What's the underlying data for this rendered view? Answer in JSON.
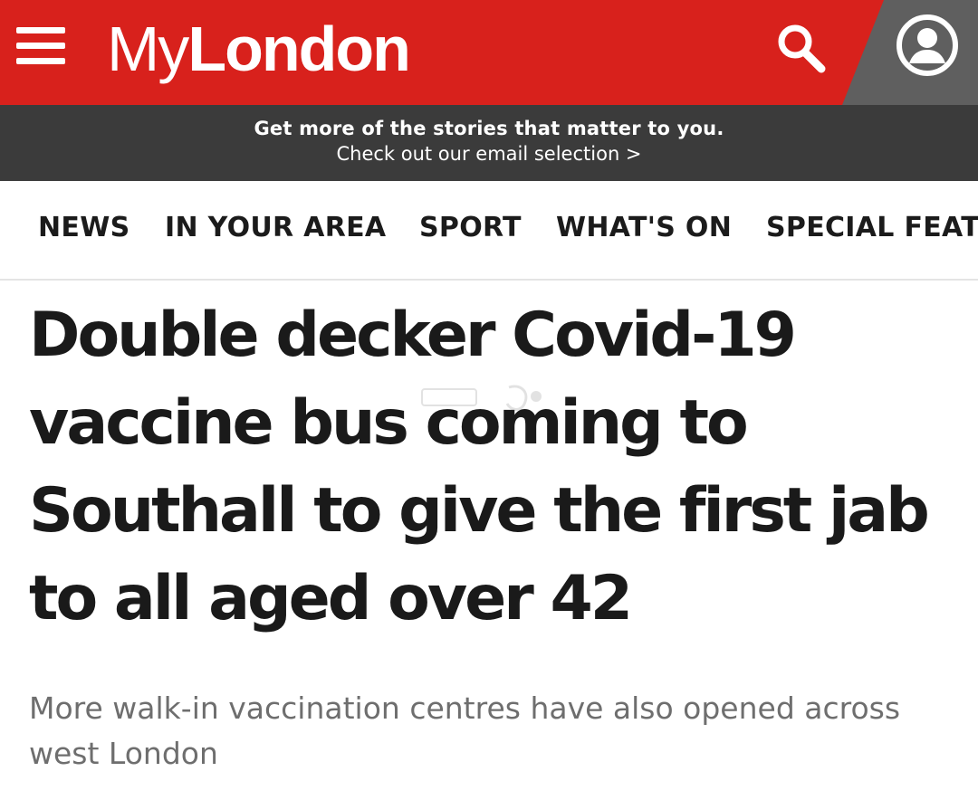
{
  "header": {
    "logo_my": "My",
    "logo_london": "London",
    "menu_icon": "hamburger-menu-icon",
    "search_icon": "search-icon",
    "account_icon": "user-account-icon",
    "brand_color": "#d8211c",
    "account_zone_color": "#5f5f5f"
  },
  "promo": {
    "line1": "Get more of the stories that matter to you.",
    "line2": "Check out our email selection >",
    "background": "#3b3b3b"
  },
  "nav": {
    "items": [
      {
        "label": "NEWS"
      },
      {
        "label": "IN YOUR AREA"
      },
      {
        "label": "SPORT"
      },
      {
        "label": "WHAT'S ON"
      },
      {
        "label": "SPECIAL FEATU"
      }
    ]
  },
  "article": {
    "headline_lines": [
      "Double decker Covid-19",
      "vaccine bus coming to",
      "Southall to give the first jab",
      "to all aged over 42"
    ],
    "standfirst_lines": [
      "More walk-in vaccination centres have also opened across",
      "west London"
    ]
  }
}
